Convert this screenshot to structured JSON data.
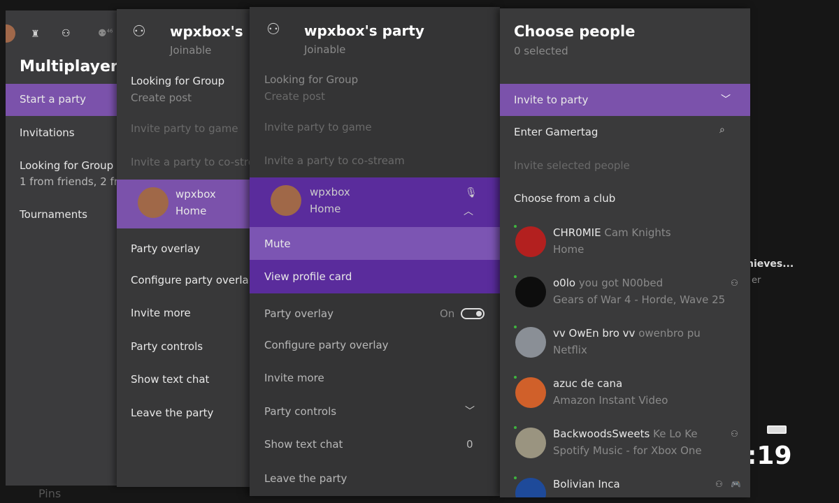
{
  "background": {
    "clock": ":19",
    "right_text_1": "hieves...",
    "right_text_2": "er",
    "bottom_text": "Pins"
  },
  "panel1": {
    "title": "Multiplayer",
    "items": [
      {
        "label": "Start a party"
      },
      {
        "label": "Invitations"
      },
      {
        "label": "Looking for Group",
        "sub": "1 from friends, 2 fr"
      },
      {
        "label": "Tournaments"
      }
    ],
    "icons": [
      "avatar",
      "trophy-icon",
      "party-icon",
      "friends-icon"
    ],
    "friends_badge": "46"
  },
  "panel2": {
    "title": "wpxbox's",
    "status": "Joinable",
    "lfg": "Looking for Group",
    "lfg_sub": "Create post",
    "invite_game": "Invite party to game",
    "invite_costream": "Invite a party to co-stre",
    "member": {
      "name": "wpxbox",
      "status": "Home"
    },
    "items": [
      "Party overlay",
      "Configure party overla",
      "Invite more",
      "Party controls",
      "Show text chat",
      "Leave the party"
    ]
  },
  "panel3": {
    "title": "wpxbox's party",
    "status": "Joinable",
    "lfg": "Looking for Group",
    "lfg_sub": "Create post",
    "invite_game": "Invite party to game",
    "invite_costream": "Invite a party to co-stream",
    "member": {
      "name": "wpxbox",
      "status": "Home"
    },
    "menu": [
      "Mute",
      "View profile card"
    ],
    "party_overlay": "Party overlay",
    "party_overlay_value": "On",
    "configure": "Configure party overlay",
    "invite_more": "Invite more",
    "party_controls": "Party controls",
    "text_chat": "Show text chat",
    "text_chat_count": "0",
    "leave": "Leave the party"
  },
  "panel4": {
    "title": "Choose people",
    "selected": "0 selected",
    "dropdown": "Invite to party",
    "gamertag": "Enter Gamertag",
    "invite_selected": "Invite selected people",
    "club": "Choose from a club",
    "friends": [
      {
        "gamertag": "CHR0MIE",
        "name": "Cam Knights",
        "activity": "Home",
        "avatar": "#b3201f"
      },
      {
        "gamertag": "o0lo",
        "name": "you got N00bed",
        "activity": "Gears of War 4 - Horde, Wave 25",
        "avatar": "#0d0d0d"
      },
      {
        "gamertag": "vv OwEn bro vv",
        "name": "owenbro pu",
        "activity": "Netflix",
        "avatar": "#8a8f96"
      },
      {
        "gamertag": "azuc de cana",
        "name": "",
        "activity": "Amazon Instant Video",
        "avatar": "#d0602a"
      },
      {
        "gamertag": "BackwoodsSweets",
        "name": "Ke Lo Ke",
        "activity": "Spotify Music - for Xbox One",
        "avatar": "#9a9480"
      },
      {
        "gamertag": "Bolivian Inca",
        "name": "",
        "activity": "",
        "avatar": "#1e4a9a"
      }
    ]
  },
  "colors": {
    "accent": "#7b52ab",
    "accent_dark": "#5a2c9c",
    "accent_light": "#7c55b3"
  }
}
